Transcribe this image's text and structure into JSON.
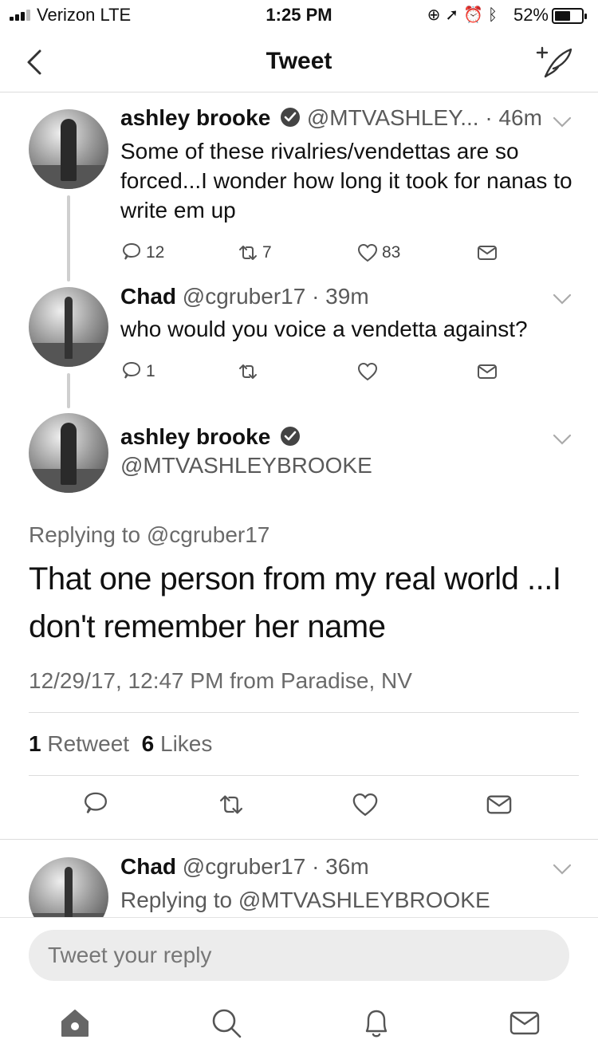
{
  "status_bar": {
    "carrier": "Verizon  LTE",
    "time": "1:25 PM",
    "battery": "52%",
    "battery_level": 0.52
  },
  "header": {
    "title": "Tweet"
  },
  "tweets": [
    {
      "name": "ashley brooke",
      "handle": "@MTVASHLEY...",
      "time": "· 46m",
      "text": "Some of these rivalries/vendettas are so forced...I wonder how long it took for nanas to write em up",
      "replies": "12",
      "retweets": "7",
      "likes": "83"
    },
    {
      "name": "Chad",
      "handle": "@cgruber17",
      "time": "· 39m",
      "text": "who would you voice a vendetta against?",
      "replies": "1",
      "retweets": "",
      "likes": ""
    }
  ],
  "focus": {
    "name": "ashley brooke",
    "handle": "@MTVASHLEYBROOKE",
    "replying_to": "Replying to @cgruber17",
    "text": "That one person from my real world ...I don't remember her name",
    "timestamp": "12/29/17, 12:47 PM from Paradise, NV",
    "retweet_count": "1",
    "retweet_label": "Retweet",
    "like_count": "6",
    "like_label": "Likes"
  },
  "reply_tweet": {
    "name": "Chad",
    "handle": "@cgruber17",
    "time": "· 36m",
    "replying_to": "Replying to @MTVASHLEYBROOKE"
  },
  "reply_bar": {
    "placeholder": "Tweet your reply"
  },
  "icons": {
    "back": "chevron-left-icon",
    "compose": "compose-feather-icon",
    "reply": "reply-bubble-icon",
    "retweet": "retweet-icon",
    "like": "heart-icon",
    "dm": "envelope-icon",
    "home": "home-icon",
    "search": "search-icon",
    "notifications": "bell-icon",
    "messages": "envelope-icon"
  }
}
